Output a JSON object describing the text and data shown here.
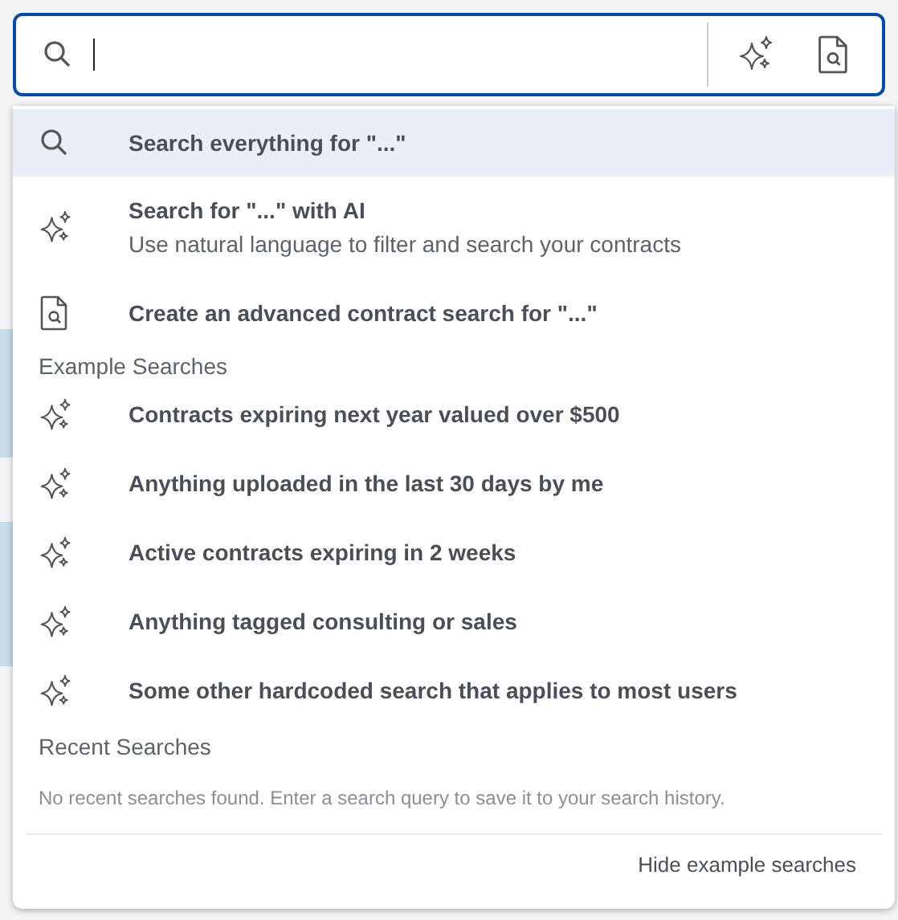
{
  "search_field": {
    "focused": true
  },
  "search_actions": [
    {
      "kind": "ai"
    },
    {
      "kind": "document"
    }
  ],
  "suggestions": [
    {
      "kind": "search",
      "title": "Search everything for \"...\"",
      "selected": true
    },
    {
      "kind": "ai",
      "title": "Search for \"...\" with AI",
      "subtitle": "Use natural language to filter and search your contracts",
      "selected": false
    },
    {
      "kind": "document",
      "title": "Create an advanced contract search for \"...\"",
      "selected": false
    }
  ],
  "example_searches": {
    "heading": "Example Searches",
    "items": [
      {
        "kind": "ai",
        "title": "Contracts expiring next year valued over $500"
      },
      {
        "kind": "ai",
        "title": "Anything uploaded in the last 30 days by me"
      },
      {
        "kind": "ai",
        "title": "Active contracts expiring in 2 weeks"
      },
      {
        "kind": "ai",
        "title": "Anything tagged consulting or sales"
      },
      {
        "kind": "ai",
        "title": "Some other hardcoded search that applies to most users"
      }
    ]
  },
  "recent_searches": {
    "heading": "Recent Searches",
    "empty_message": "No recent searches found. Enter a search query to save it to your search history."
  },
  "footer_link": "Hide example searches"
}
